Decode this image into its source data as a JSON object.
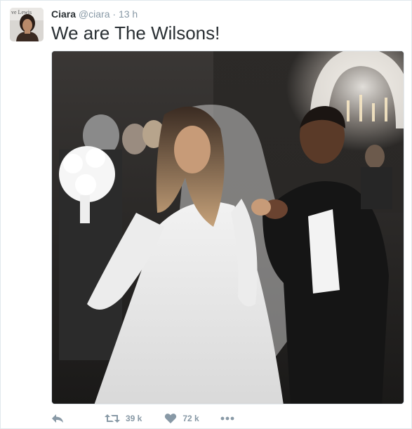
{
  "tweet": {
    "display_name": "Ciara",
    "handle": "@ciara",
    "separator": "·",
    "time": "13 h",
    "text": "We are The Wilsons!",
    "avatar_text": "ve Lewis",
    "retweet_count": "39 k",
    "like_count": "72 k"
  },
  "icons": {
    "reply": "reply-icon",
    "retweet": "retweet-icon",
    "like": "heart-icon",
    "more": "more-icon"
  },
  "colors": {
    "text": "#292f33",
    "muted": "#8899a6",
    "border": "#e1e8ed"
  }
}
